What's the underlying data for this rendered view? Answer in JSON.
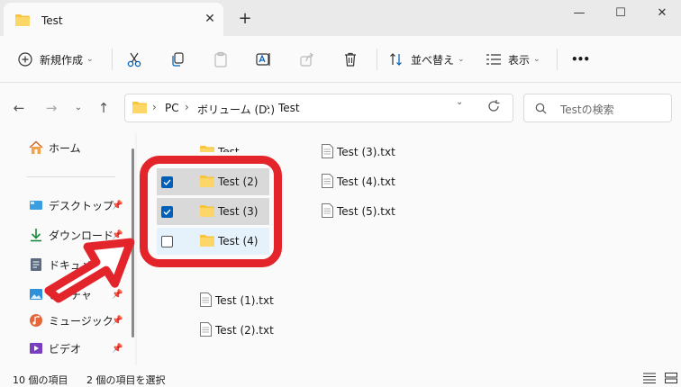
{
  "window": {
    "tab_title": "Test",
    "tab_close": "✕",
    "new_tab": "+",
    "minimize": "—",
    "maximize": "☐",
    "close": "✕"
  },
  "toolbar": {
    "new_label": "新規作成",
    "sort_label": "並べ替え",
    "view_label": "表示",
    "more": "•••"
  },
  "address": {
    "root": "PC",
    "volume": "ボリューム (D:)",
    "folder": "Test",
    "sep": "›"
  },
  "search": {
    "placeholder": "Testの検索"
  },
  "sidebar": {
    "home": "ホーム",
    "items": [
      {
        "label": "デスクトップ",
        "icon": "desktop-icon",
        "pinned": true
      },
      {
        "label": "ダウンロード",
        "icon": "download-icon",
        "pinned": true
      },
      {
        "label": "ドキュメント",
        "icon": "document-icon",
        "pinned": true
      },
      {
        "label": "ピクチャ",
        "icon": "picture-icon",
        "pinned": true
      },
      {
        "label": "ミュージック",
        "icon": "music-icon",
        "pinned": true
      },
      {
        "label": "ビデオ",
        "icon": "video-icon",
        "pinned": true
      }
    ]
  },
  "files": {
    "col1": [
      {
        "name": "Test",
        "type": "folder",
        "checked": false
      },
      {
        "name": "Test (2)",
        "type": "folder",
        "checked": true
      },
      {
        "name": "Test (3)",
        "type": "folder",
        "checked": true
      },
      {
        "name": "Test (4)",
        "type": "folder",
        "checked": false
      },
      {
        "name": "Test (1).txt",
        "type": "text"
      },
      {
        "name": "Test (2).txt",
        "type": "text"
      }
    ],
    "col2": [
      {
        "name": "Test (3).txt",
        "type": "text"
      },
      {
        "name": "Test (4).txt",
        "type": "text"
      },
      {
        "name": "Test (5).txt",
        "type": "text"
      }
    ]
  },
  "status": {
    "count": "10 個の項目",
    "selected": "2 個の項目を選択"
  },
  "colors": {
    "accent": "#005fb8",
    "highlight_red": "#e3242b",
    "folder_yellow": "#f8c43a",
    "selection_gray": "#d9d9d9",
    "hover_blue": "#e5f1fb"
  }
}
